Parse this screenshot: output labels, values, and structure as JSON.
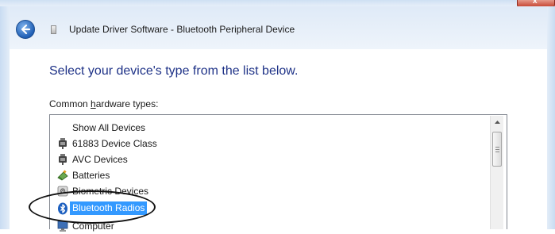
{
  "window": {
    "title": "Update Driver Software - Bluetooth Peripheral Device",
    "close_label": "x"
  },
  "page": {
    "heading": "Select your device's type from the list below.",
    "common_label_pre": "Common ",
    "common_label_key": "h",
    "common_label_post": "ardware types:"
  },
  "hardware_types": [
    {
      "label": "Show All Devices",
      "icon": "none",
      "selected": false
    },
    {
      "label": "61883 Device Class",
      "icon": "connector-icon",
      "selected": false
    },
    {
      "label": "AVC Devices",
      "icon": "connector-icon",
      "selected": false
    },
    {
      "label": "Batteries",
      "icon": "battery-icon",
      "selected": false
    },
    {
      "label": "Biometric Devices",
      "icon": "fingerprint-icon",
      "selected": false
    },
    {
      "label": "Bluetooth Radios",
      "icon": "bluetooth-icon",
      "selected": true
    },
    {
      "label": "Computer",
      "icon": "computer-icon",
      "selected": false
    }
  ],
  "colors": {
    "selection": "#3399ff",
    "heading": "#1e3287"
  }
}
